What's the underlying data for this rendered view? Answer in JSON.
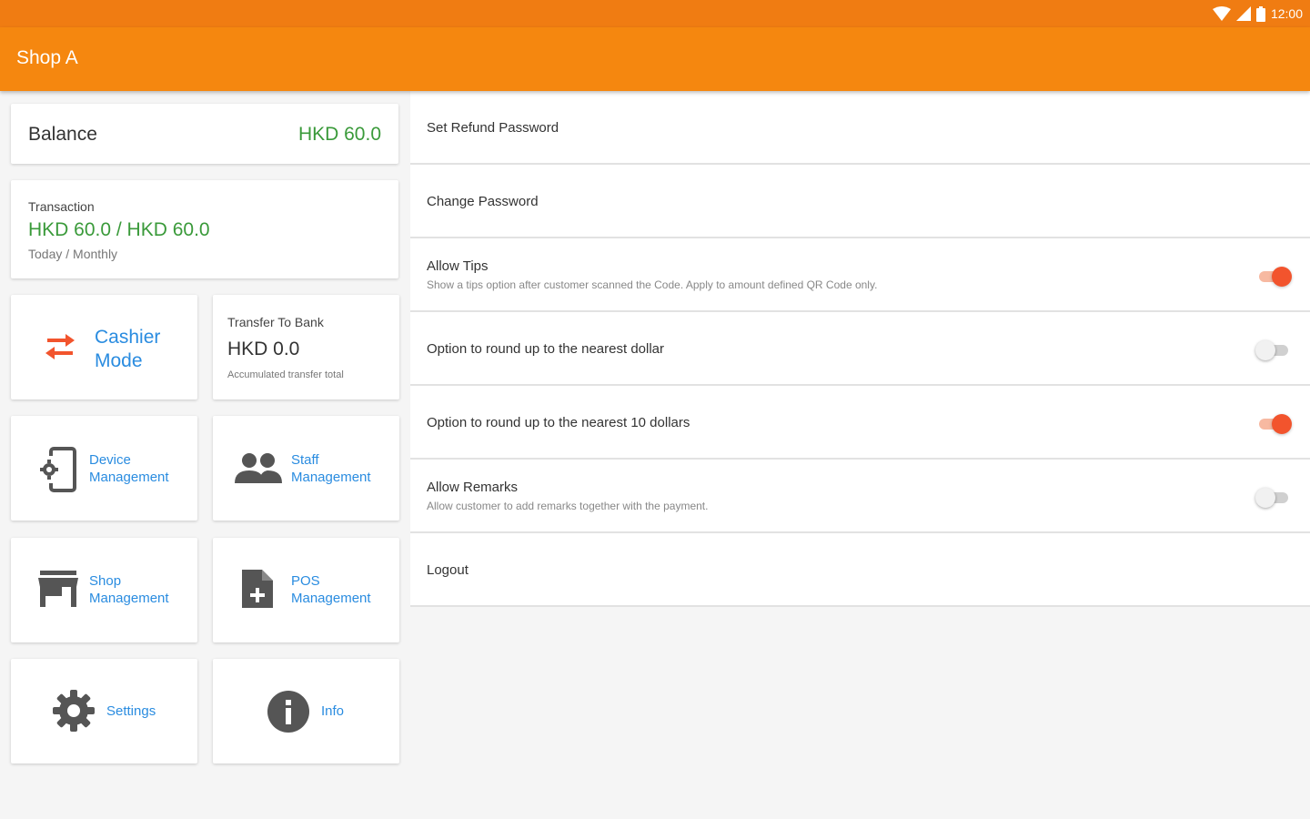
{
  "status_bar": {
    "time": "12:00"
  },
  "app_bar": {
    "title": "Shop A"
  },
  "balance": {
    "label": "Balance",
    "value": "HKD 60.0"
  },
  "transaction": {
    "label": "Transaction",
    "value": "HKD 60.0 / HKD 60.0",
    "sub": "Today / Monthly"
  },
  "cashier": {
    "label": "Cashier Mode",
    "icon": "swap-arrows-icon"
  },
  "transfer": {
    "label": "Transfer To Bank",
    "value": "HKD 0.0",
    "sub": "Accumulated transfer total"
  },
  "tiles": {
    "device": {
      "label": "Device Management",
      "icon": "device-settings-icon"
    },
    "staff": {
      "label": "Staff Management",
      "icon": "people-icon"
    },
    "shop": {
      "label": "Shop Management",
      "icon": "store-icon"
    },
    "pos": {
      "label": "POS Management",
      "icon": "add-document-icon"
    },
    "settings": {
      "label": "Settings",
      "icon": "gear-icon"
    },
    "info": {
      "label": "Info",
      "icon": "info-icon"
    }
  },
  "settings_list": [
    {
      "title": "Set Refund Password"
    },
    {
      "title": "Change Password"
    },
    {
      "title": "Allow Tips",
      "sub": "Show a tips option after customer scanned the Code. Apply to amount defined QR Code only.",
      "toggle": true
    },
    {
      "title": "Option to round up to the nearest dollar",
      "toggle": false
    },
    {
      "title": "Option to round up to the nearest 10 dollars",
      "toggle": true
    },
    {
      "title": "Allow Remarks",
      "sub": "Allow customer to add remarks together with the payment.",
      "toggle": false
    },
    {
      "title": "Logout"
    }
  ],
  "colors": {
    "accent": "#f5870f",
    "money": "#3a9a3a",
    "link": "#2a8ce0",
    "toggle_on": "#f2542d"
  }
}
